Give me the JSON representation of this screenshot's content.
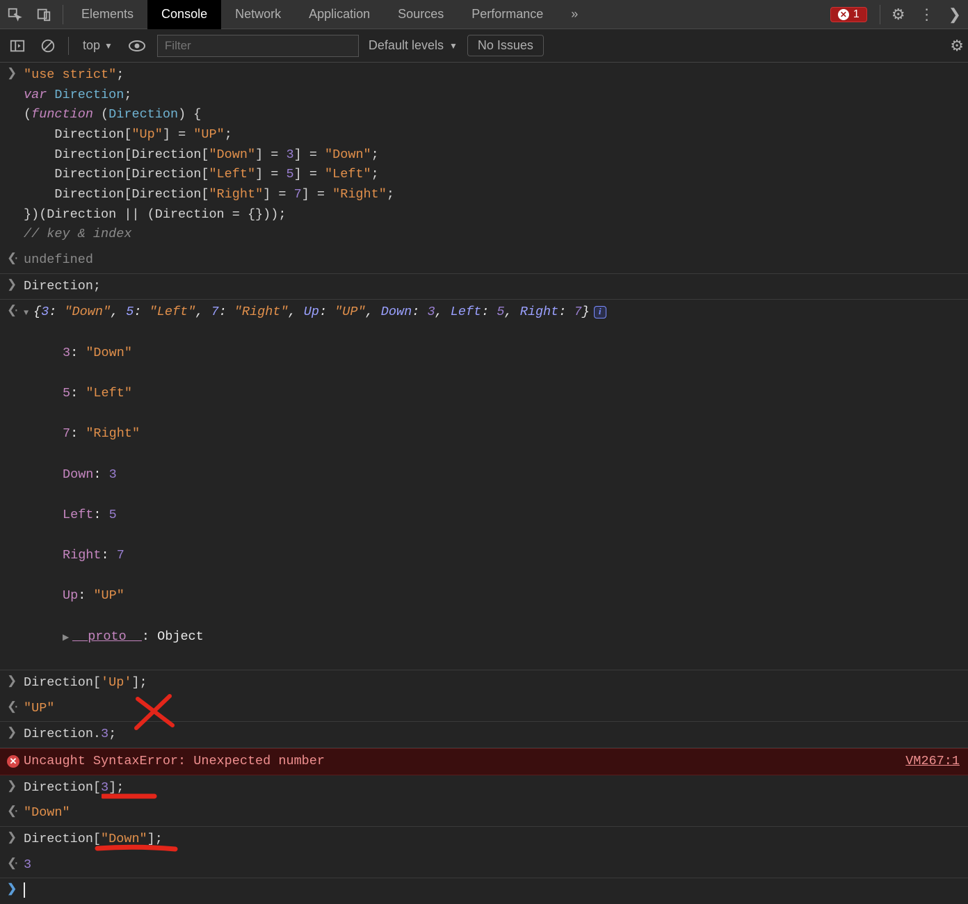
{
  "tabs": {
    "items": [
      "Elements",
      "Console",
      "Network",
      "Application",
      "Sources",
      "Performance"
    ],
    "active_index": 1,
    "more_glyph": "»",
    "error_count": "1"
  },
  "toolbar": {
    "context": "top",
    "filter_placeholder": "Filter",
    "levels_label": "Default levels",
    "no_issues": "No Issues"
  },
  "code1": {
    "l1a": "\"use strict\"",
    "l1b": ";",
    "l2a": "var",
    "l2b": " Direction",
    "l2c": ";",
    "l3a": "(",
    "l3b": "function",
    "l3c": " (",
    "l3d": "Direction",
    "l3e": ") {",
    "l4a": "    Direction[",
    "l4b": "\"Up\"",
    "l4c": "] = ",
    "l4d": "\"UP\"",
    "l4e": ";",
    "l5a": "    Direction[Direction[",
    "l5b": "\"Down\"",
    "l5c": "] = ",
    "l5d": "3",
    "l5e": "] = ",
    "l5f": "\"Down\"",
    "l5g": ";",
    "l6a": "    Direction[Direction[",
    "l6b": "\"Left\"",
    "l6c": "] = ",
    "l6d": "5",
    "l6e": "] = ",
    "l6f": "\"Left\"",
    "l6g": ";",
    "l7a": "    Direction[Direction[",
    "l7b": "\"Right\"",
    "l7c": "] = ",
    "l7d": "7",
    "l7e": "] = ",
    "l7f": "\"Right\"",
    "l7g": ";",
    "l8": "})(Direction || (Direction = {}));",
    "l9": "// key & index"
  },
  "out1": "undefined",
  "in2": "Direction;",
  "preview": {
    "open": "{",
    "p1k": "3",
    "p1v": "\"Down\"",
    "p2k": "5",
    "p2v": "\"Left\"",
    "p3k": "7",
    "p3v": "\"Right\"",
    "p4k": "Up",
    "p4v": "\"UP\"",
    "p5k": "Down",
    "p5v": "3",
    "p6k": "Left",
    "p6v": "5",
    "p7k": "Right",
    "p7v": "7",
    "close": "}"
  },
  "expanded": {
    "e1k": "3",
    "e1v": "\"Down\"",
    "e2k": "5",
    "e2v": "\"Left\"",
    "e3k": "7",
    "e3v": "\"Right\"",
    "e4k": "Down",
    "e4v": "3",
    "e5k": "Left",
    "e5v": "5",
    "e6k": "Right",
    "e6v": "7",
    "e7k": "Up",
    "e7v": "\"UP\"",
    "proto": "__proto__",
    "proto_v": "Object"
  },
  "in3_a": "Direction[",
  "in3_b": "'Up'",
  "in3_c": "];",
  "out3": "\"UP\"",
  "in4_a": "Direction.",
  "in4_b": "3",
  "in4_c": ";",
  "error": {
    "msg": "Uncaught SyntaxError: Unexpected number",
    "src": "VM267:1"
  },
  "in5_a": "Direction[",
  "in5_b": "3",
  "in5_c": "];",
  "out5": "\"Down\"",
  "in6_a": "Direction[",
  "in6_b": "\"Down\"",
  "in6_c": "];",
  "out6": "3"
}
